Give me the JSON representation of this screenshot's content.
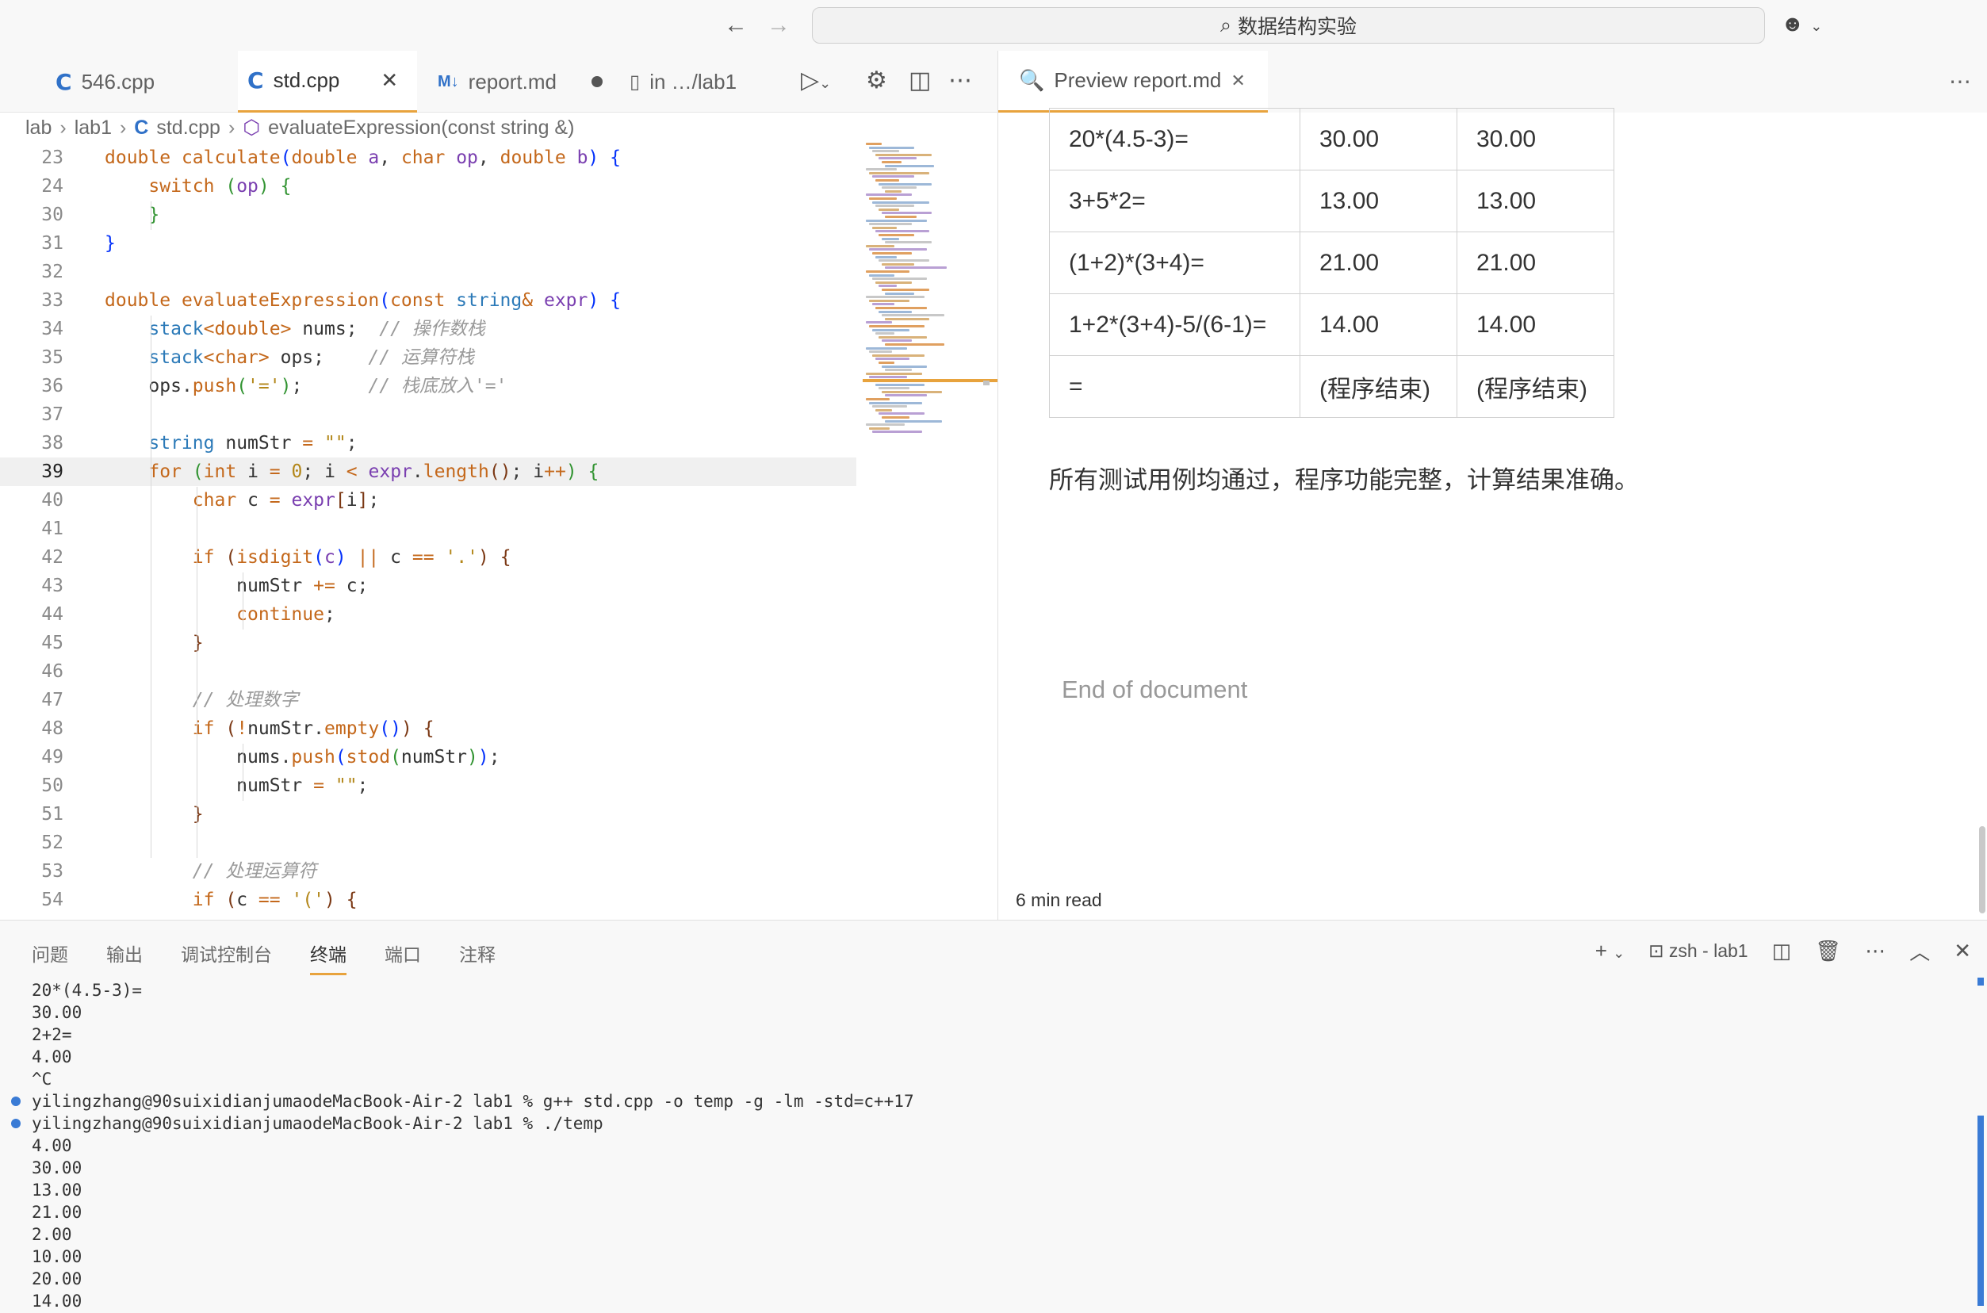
{
  "titlebar": {
    "search_text": "数据结构实验"
  },
  "editor": {
    "tabs": [
      {
        "label": "546.cpp"
      },
      {
        "label": "std.cpp"
      },
      {
        "label": "report.md"
      },
      {
        "label": "in  …/lab1"
      }
    ],
    "breadcrumb": [
      "lab",
      "lab1",
      "std.cpp",
      "evaluateExpression(const string &)"
    ]
  },
  "code_lines": [
    {
      "num": "23",
      "html": "<span class='k'>double</span> <span class='f'>calculate</span><span class='b1'>(</span><span class='k'>double</span> <span class='v'>a</span>, <span class='k'>char</span> <span class='v'>op</span>, <span class='k'>double</span> <span class='v'>b</span><span class='b1'>)</span> <span class='b1'>{</span>"
    },
    {
      "num": "24",
      "html": "    <span class='k'>switch</span> <span class='b2'>(</span><span class='v'>op</span><span class='b2'>)</span> <span class='b2'>{</span>"
    },
    {
      "num": "30",
      "html": "    <span class='b2'>}</span>"
    },
    {
      "num": "31",
      "html": "<span class='b1'>}</span>"
    },
    {
      "num": "32",
      "html": ""
    },
    {
      "num": "33",
      "html": "<span class='k'>double</span> <span class='f'>evaluateExpression</span><span class='b1'>(</span><span class='k'>const</span> <span class='t'>string</span><span class='o'>&amp;</span> <span class='v'>expr</span><span class='b1'>)</span> <span class='b1'>{</span>"
    },
    {
      "num": "34",
      "html": "    <span class='t'>stack</span><span class='o'>&lt;</span><span class='k'>double</span><span class='o'>&gt;</span> <span class='n'>nums</span>;  <span class='c'>// 操作数栈</span>"
    },
    {
      "num": "35",
      "html": "    <span class='t'>stack</span><span class='o'>&lt;</span><span class='k'>char</span><span class='o'>&gt;</span> <span class='n'>ops</span>;    <span class='c'>// 运算符栈</span>"
    },
    {
      "num": "36",
      "html": "    <span class='n'>ops</span>.<span class='f'>push</span><span class='b2'>(</span><span class='s'>'='</span><span class='b2'>)</span>;      <span class='c'>// 栈底放入'='</span>"
    },
    {
      "num": "37",
      "html": ""
    },
    {
      "num": "38",
      "html": "    <span class='t'>string</span> <span class='n'>numStr</span> <span class='o'>=</span> <span class='s'>\"\"</span>;"
    },
    {
      "num": "39",
      "html": "    <span class='k'>for</span> <span class='b2'>(</span><span class='k'>int</span> <span class='n'>i</span> <span class='o'>=</span> <span class='s'>0</span>; <span class='n'>i</span> <span class='o'>&lt;</span> <span class='v'>expr</span>.<span class='f'>length</span><span class='b3'>()</span>; <span class='n'>i</span><span class='o'>++</span><span class='b2'>)</span> <span class='b2'>{</span>",
      "current": true
    },
    {
      "num": "40",
      "html": "        <span class='k'>char</span> <span class='n'>c</span> <span class='o'>=</span> <span class='v'>expr</span><span class='b3'>[</span><span class='n'>i</span><span class='b3'>]</span>;"
    },
    {
      "num": "41",
      "html": ""
    },
    {
      "num": "42",
      "html": "        <span class='k'>if</span> <span class='b3'>(</span><span class='f'>isdigit</span><span class='b1'>(</span><span class='v'>c</span><span class='b1'>)</span> <span class='o'>||</span> <span class='n'>c</span> <span class='o'>==</span> <span class='s'>'.'</span><span class='b3'>)</span> <span class='b3'>{</span>"
    },
    {
      "num": "43",
      "html": "            <span class='n'>numStr</span> <span class='o'>+=</span> <span class='n'>c</span>;"
    },
    {
      "num": "44",
      "html": "            <span class='k'>continue</span>;"
    },
    {
      "num": "45",
      "html": "        <span class='b3'>}</span>"
    },
    {
      "num": "46",
      "html": ""
    },
    {
      "num": "47",
      "html": "        <span class='c'>// 处理数字</span>"
    },
    {
      "num": "48",
      "html": "        <span class='k'>if</span> <span class='b3'>(</span><span class='o'>!</span><span class='n'>numStr</span>.<span class='f'>empty</span><span class='b1'>()</span><span class='b3'>)</span> <span class='b3'>{</span>"
    },
    {
      "num": "49",
      "html": "            <span class='n'>nums</span>.<span class='f'>push</span><span class='b1'>(</span><span class='f'>stod</span><span class='b2'>(</span><span class='n'>numStr</span><span class='b2'>)</span><span class='b1'>)</span>;"
    },
    {
      "num": "50",
      "html": "            <span class='n'>numStr</span> <span class='o'>=</span> <span class='s'>\"\"</span>;"
    },
    {
      "num": "51",
      "html": "        <span class='b3'>}</span>"
    },
    {
      "num": "52",
      "html": ""
    },
    {
      "num": "53",
      "html": "        <span class='c'>// 处理运算符</span>"
    },
    {
      "num": "54",
      "html": "        <span class='k'>if</span> <span class='b3'>(</span><span class='n'>c</span> <span class='o'>==</span> <span class='s'>'('</span><span class='b3'>)</span> <span class='b3'>{</span>"
    }
  ],
  "preview": {
    "tab_label": "Preview report.md",
    "table_rows": [
      [
        "20*(4.5-3)=",
        "30.00",
        "30.00"
      ],
      [
        "3+5*2=",
        "13.00",
        "13.00"
      ],
      [
        "(1+2)*(3+4)=",
        "21.00",
        "21.00"
      ],
      [
        "1+2*(3+4)-5/(6-1)=",
        "14.00",
        "14.00"
      ],
      [
        "=",
        "(程序结束)",
        "(程序结束)"
      ]
    ],
    "summary": "所有测试用例均通过，程序功能完整，计算结果准确。",
    "end_of_document": "End of document",
    "read_time": "6 min read"
  },
  "panel": {
    "tabs": [
      "问题",
      "输出",
      "调试控制台",
      "终端",
      "端口",
      "注释"
    ],
    "active_tab": "终端",
    "terminal_name": "zsh - lab1",
    "terminal_lines": [
      {
        "text": "20*(4.5-3)="
      },
      {
        "text": "30.00"
      },
      {
        "text": "2+2="
      },
      {
        "text": "4.00"
      },
      {
        "text": "^C"
      },
      {
        "text": "yilingzhang@90suixidianjumaodeMacBook-Air-2 lab1 % g++ std.cpp -o temp -g -lm -std=c++17",
        "prompt": true
      },
      {
        "text": "yilingzhang@90suixidianjumaodeMacBook-Air-2 lab1 % ./temp",
        "prompt": true
      },
      {
        "text": "4.00"
      },
      {
        "text": "30.00"
      },
      {
        "text": "13.00"
      },
      {
        "text": "21.00"
      },
      {
        "text": "2.00"
      },
      {
        "text": "10.00"
      },
      {
        "text": "20.00"
      },
      {
        "text": "14.00"
      }
    ]
  },
  "colors": {
    "accent": "#e8a33d",
    "file_icon": "#3071c8",
    "terminal_marker": "#3a7bd5"
  }
}
